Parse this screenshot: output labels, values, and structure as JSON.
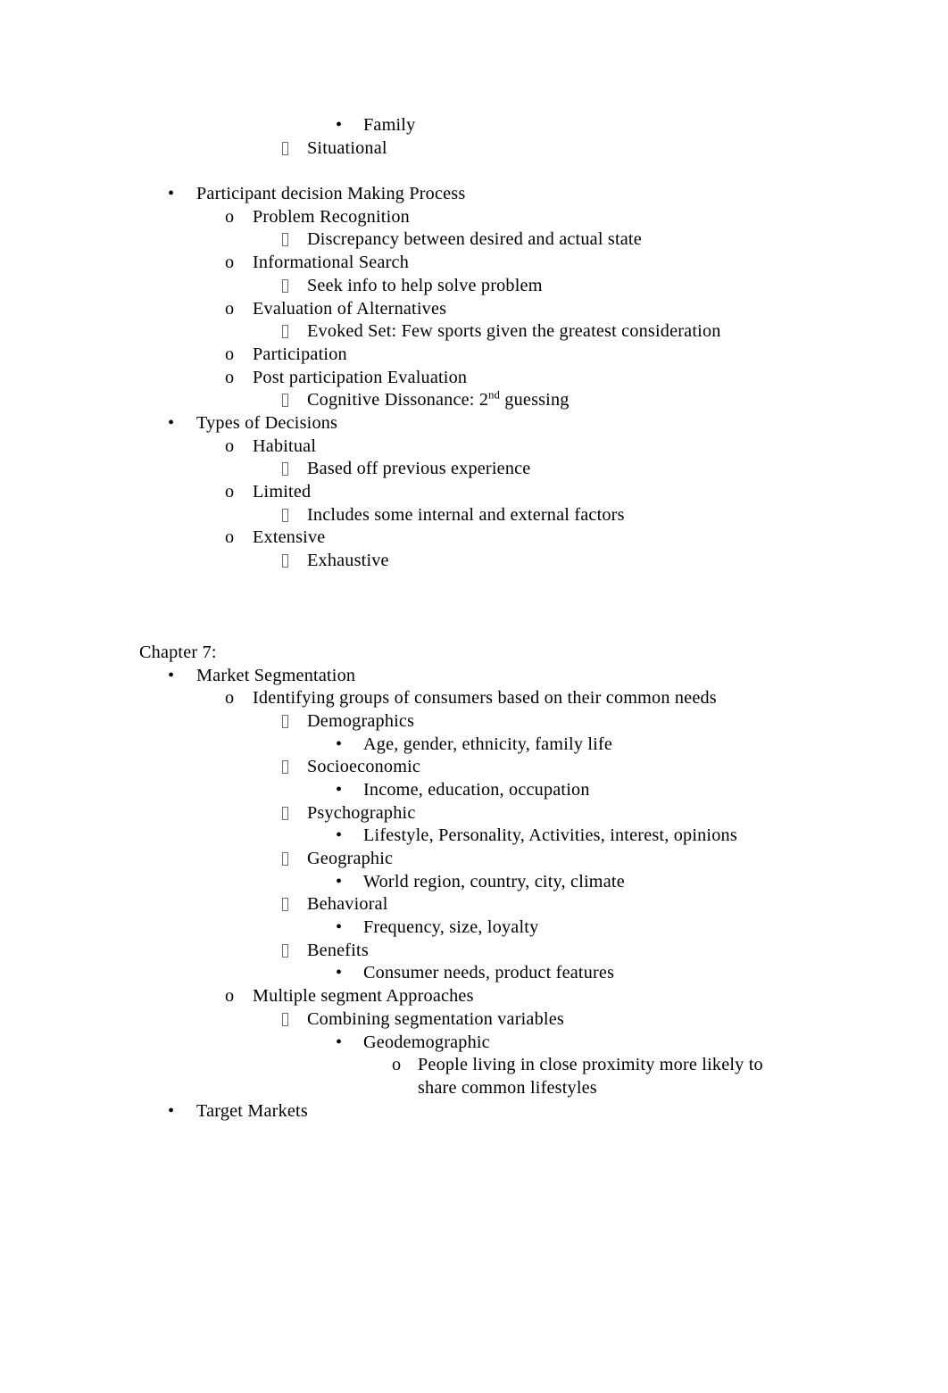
{
  "document": {
    "page_background": "#ffffff",
    "text_color": "#000000",
    "marker_box_color": "#6f6f6f",
    "markers": {
      "disc": "•",
      "circle": "o",
      "box": "missing-glyph-box"
    },
    "blocks": [
      {
        "id": "b1",
        "level": 4,
        "marker": "disc",
        "text": "Family"
      },
      {
        "id": "b2",
        "level": 3,
        "marker": "box",
        "text": "Situational"
      },
      {
        "id": "b3",
        "level": 0,
        "marker": "none",
        "text": ""
      },
      {
        "id": "b4",
        "level": 1,
        "marker": "disc",
        "text": "Participant decision Making Process"
      },
      {
        "id": "b5",
        "level": 2,
        "marker": "circle",
        "text": "Problem Recognition"
      },
      {
        "id": "b6",
        "level": 3,
        "marker": "box",
        "text": "Discrepancy between desired and actual state"
      },
      {
        "id": "b7",
        "level": 2,
        "marker": "circle",
        "text": "Informational Search"
      },
      {
        "id": "b8",
        "level": 3,
        "marker": "box",
        "text": "Seek info to help solve problem"
      },
      {
        "id": "b9",
        "level": 2,
        "marker": "circle",
        "text": "Evaluation of Alternatives"
      },
      {
        "id": "b10",
        "level": 3,
        "marker": "box",
        "text": "Evoked Set: Few sports given the greatest consideration"
      },
      {
        "id": "b11",
        "level": 2,
        "marker": "circle",
        "text": "Participation"
      },
      {
        "id": "b12",
        "level": 2,
        "marker": "circle",
        "text": "Post participation Evaluation"
      },
      {
        "id": "b13",
        "level": 3,
        "marker": "box",
        "text_prefix": "Cognitive Dissonance: 2",
        "superscript": "nd",
        "text_suffix": " guessing"
      },
      {
        "id": "b14",
        "level": 1,
        "marker": "disc",
        "text": "Types of Decisions"
      },
      {
        "id": "b15",
        "level": 2,
        "marker": "circle",
        "text": "Habitual"
      },
      {
        "id": "b16",
        "level": 3,
        "marker": "box",
        "text": "Based off previous experience"
      },
      {
        "id": "b17",
        "level": 2,
        "marker": "circle",
        "text": "Limited"
      },
      {
        "id": "b18",
        "level": 3,
        "marker": "box",
        "text": "Includes some internal and external factors"
      },
      {
        "id": "b19",
        "level": 2,
        "marker": "circle",
        "text": "Extensive"
      },
      {
        "id": "b20",
        "level": 3,
        "marker": "box",
        "text": "Exhaustive"
      },
      {
        "id": "b21",
        "level": 0,
        "marker": "none",
        "text": "Chapter 7:"
      },
      {
        "id": "b22",
        "level": 1,
        "marker": "disc",
        "text": "Market Segmentation"
      },
      {
        "id": "b23",
        "level": 2,
        "marker": "circle",
        "text": "Identifying groups of consumers based on their common needs"
      },
      {
        "id": "b24",
        "level": 3,
        "marker": "box",
        "text": "Demographics"
      },
      {
        "id": "b25",
        "level": 4,
        "marker": "disc",
        "text": "Age, gender, ethnicity, family life"
      },
      {
        "id": "b26",
        "level": 3,
        "marker": "box",
        "text": "Socioeconomic"
      },
      {
        "id": "b27",
        "level": 4,
        "marker": "disc",
        "text": "Income, education, occupation"
      },
      {
        "id": "b28",
        "level": 3,
        "marker": "box",
        "text": "Psychographic"
      },
      {
        "id": "b29",
        "level": 4,
        "marker": "disc",
        "text": "Lifestyle, Personality, Activities, interest, opinions"
      },
      {
        "id": "b30",
        "level": 3,
        "marker": "box",
        "text": "Geographic"
      },
      {
        "id": "b31",
        "level": 4,
        "marker": "disc",
        "text": "World region, country, city, climate"
      },
      {
        "id": "b32",
        "level": 3,
        "marker": "box",
        "text": "Behavioral"
      },
      {
        "id": "b33",
        "level": 4,
        "marker": "disc",
        "text": "Frequency, size, loyalty"
      },
      {
        "id": "b34",
        "level": 3,
        "marker": "box",
        "text": "Benefits"
      },
      {
        "id": "b35",
        "level": 4,
        "marker": "disc",
        "text": "Consumer needs, product features"
      },
      {
        "id": "b36",
        "level": 2,
        "marker": "circle",
        "text": "Multiple segment Approaches"
      },
      {
        "id": "b37",
        "level": 3,
        "marker": "box",
        "text": "Combining segmentation variables"
      },
      {
        "id": "b38",
        "level": 4,
        "marker": "disc",
        "text": "Geodemographic"
      },
      {
        "id": "b39",
        "level": 5,
        "marker": "circle",
        "text": "People living in close proximity more likely to share common lifestyles"
      },
      {
        "id": "b40",
        "level": 1,
        "marker": "disc",
        "text": "Target Markets"
      }
    ]
  },
  "lines": {
    "l01_family": "Family",
    "l02_situational": "Situational",
    "l04_participant_decision": "Participant decision Making Process",
    "l05_problem_recognition": "Problem Recognition",
    "l06_discrepancy": "Discrepancy between desired and actual state",
    "l07_informational_search": "Informational Search",
    "l08_seek_info": "Seek info to help solve problem",
    "l09_evaluation_alternatives": "Evaluation of Alternatives",
    "l10_evoked_set": "Evoked Set: Few sports given the greatest consideration",
    "l11_participation": "Participation",
    "l12_post_participation": "Post participation Evaluation",
    "l13_cognitive_prefix": "Cognitive Dissonance: 2",
    "l13_cognitive_sup": "nd",
    "l13_cognitive_suffix": " guessing",
    "l14_types_decisions": "Types of Decisions",
    "l15_habitual": "Habitual",
    "l16_based_off": "Based off previous experience",
    "l17_limited": "Limited",
    "l18_includes_some": "Includes some internal and external factors",
    "l19_extensive": "Extensive",
    "l20_exhaustive": "Exhaustive",
    "l21_chapter7": "Chapter 7:",
    "l22_market_segmentation": "Market Segmentation",
    "l23_identifying_groups": "Identifying groups of consumers based on their common needs",
    "l24_demographics": "Demographics",
    "l25_age_gender": "Age, gender, ethnicity, family life",
    "l26_socioeconomic": "Socioeconomic",
    "l27_income_education": "Income, education, occupation",
    "l28_psychographic": "Psychographic",
    "l29_lifestyle": "Lifestyle, Personality, Activities, interest, opinions",
    "l30_geographic": "Geographic",
    "l31_world_region": "World region, country, city, climate",
    "l32_behavioral": "Behavioral",
    "l33_frequency_size": "Frequency, size, loyalty",
    "l34_benefits": "Benefits",
    "l35_consumer_needs": "Consumer needs, product features",
    "l36_multiple_segment": "Multiple segment Approaches",
    "l37_combining_segmentation": "Combining segmentation variables",
    "l38_geodemographic": "Geodemographic",
    "l39_people_living": "People living in close proximity more likely to share common lifestyles",
    "l40_target_markets": "Target Markets"
  },
  "markers": {
    "disc": "•",
    "circle": "o"
  }
}
